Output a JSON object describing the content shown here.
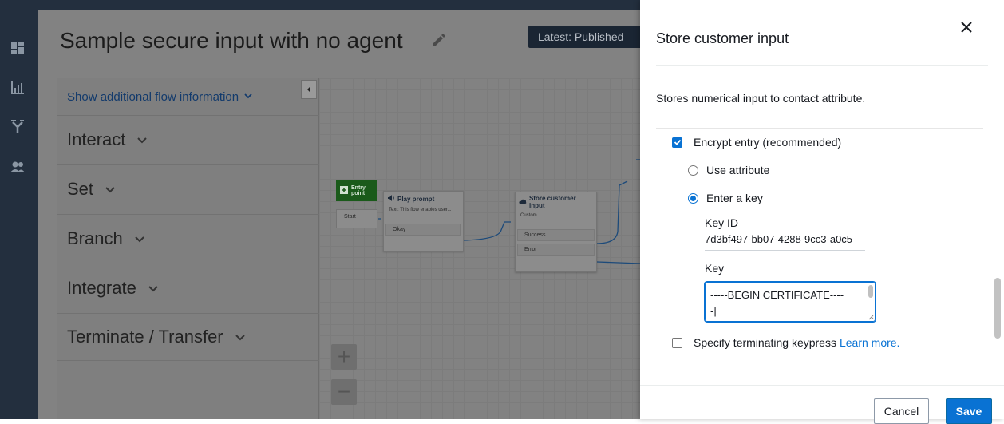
{
  "flow": {
    "title": "Sample secure input with no agent",
    "status": "Latest: Published"
  },
  "side_panel": {
    "flow_info_link": "Show additional flow information",
    "categories": [
      "Interact",
      "Set",
      "Branch",
      "Integrate",
      "Terminate / Transfer"
    ]
  },
  "canvas": {
    "entry_label": "Entry point",
    "entry_start": "Start",
    "play_prompt": {
      "title": "Play prompt",
      "text": "Text: This flow enables user...",
      "branch": "Okay"
    },
    "store_input": {
      "title": "Store customer input",
      "subtitle": "Custom",
      "branches": [
        "Success",
        "Error"
      ]
    },
    "zoom_in": "+",
    "zoom_out": "−"
  },
  "modal": {
    "title": "Store customer input",
    "description": "Stores numerical input to contact attribute.",
    "encrypt_label": "Encrypt entry (recommended)",
    "encrypt_checked": true,
    "use_attribute_label": "Use attribute",
    "enter_key_label": "Enter a key",
    "selected_option": "Enter a key",
    "key_id_label": "Key ID",
    "key_id_value": "7d3bf497-bb07-4288-9cc3-a0c5",
    "key_label": "Key",
    "key_value_line1": "-----BEGIN CERTIFICATE----",
    "key_value_line2": "-|",
    "terminating_label": "Specify terminating keypress",
    "terminating_checked": false,
    "learn_more": "Learn more.",
    "cancel": "Cancel",
    "save": "Save"
  },
  "colors": {
    "accent": "#0972d3",
    "nav_bg": "#232f3e",
    "entry_green": "#1a5a1a"
  },
  "icons": {
    "nav": [
      "dashboard-icon",
      "metrics-icon",
      "routing-icon",
      "users-icon"
    ],
    "close": "close-icon",
    "edit": "pencil-icon"
  }
}
